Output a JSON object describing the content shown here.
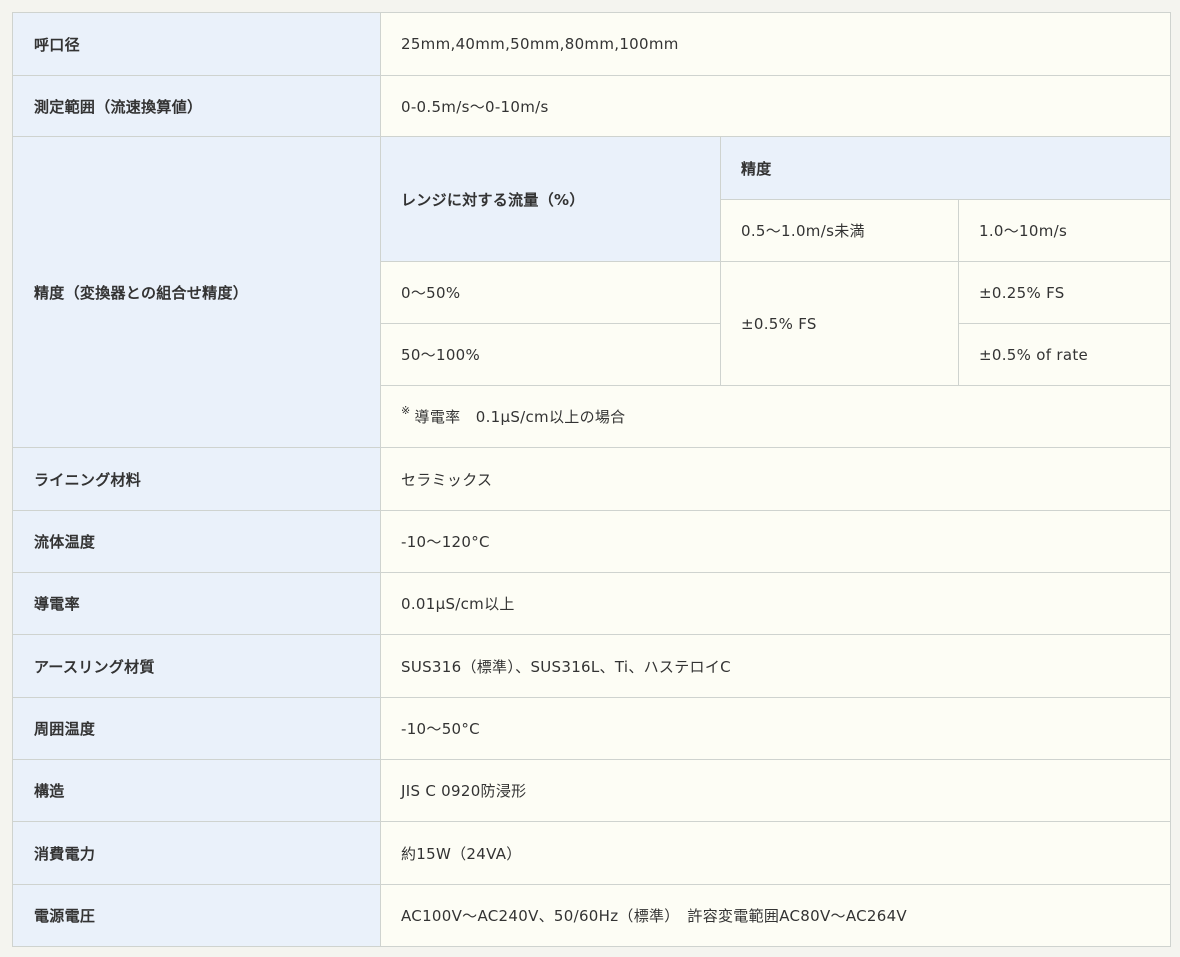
{
  "rows": {
    "bore": {
      "label": "呼口径",
      "value": "25mm,40mm,50mm,80mm,100mm"
    },
    "range": {
      "label": "測定範囲（流速換算値）",
      "value": "0-0.5m/s〜0-10m/s"
    },
    "accuracy": {
      "label": "精度（変換器との組合せ精度）",
      "flow_header": "レンジに対する流量（%）",
      "accuracy_header": "精度",
      "speed_low": "0.5〜1.0m/s未満",
      "speed_high": "1.0〜10m/s",
      "flow_low": "0〜50%",
      "flow_high": "50〜100%",
      "shared_value": "±0.5% FS",
      "high_low_value": "±0.25% FS",
      "high_high_value": "±0.5% of rate",
      "note_mark": "※",
      "note": "導電率　0.1µS/cm以上の場合"
    },
    "lining": {
      "label": "ライニング材料",
      "value": "セラミックス"
    },
    "fluid_temp": {
      "label": "流体温度",
      "value": "-10〜120°C"
    },
    "conductivity": {
      "label": "導電率",
      "value": "0.01µS/cm以上"
    },
    "earth_ring": {
      "label": "アースリング材質",
      "value": "SUS316（標準）、SUS316L、Ti、ハステロイC"
    },
    "ambient_temp": {
      "label": "周囲温度",
      "value": "-10〜50°C"
    },
    "structure": {
      "label": "構造",
      "value": "JIS C 0920防浸形"
    },
    "power_consumption": {
      "label": "消費電力",
      "value": "約15W（24VA）"
    },
    "power_voltage": {
      "label": "電源電圧",
      "value": "AC100V〜AC240V、50/60Hz（標準）　許容変電範囲AC80V〜AC264V"
    }
  }
}
